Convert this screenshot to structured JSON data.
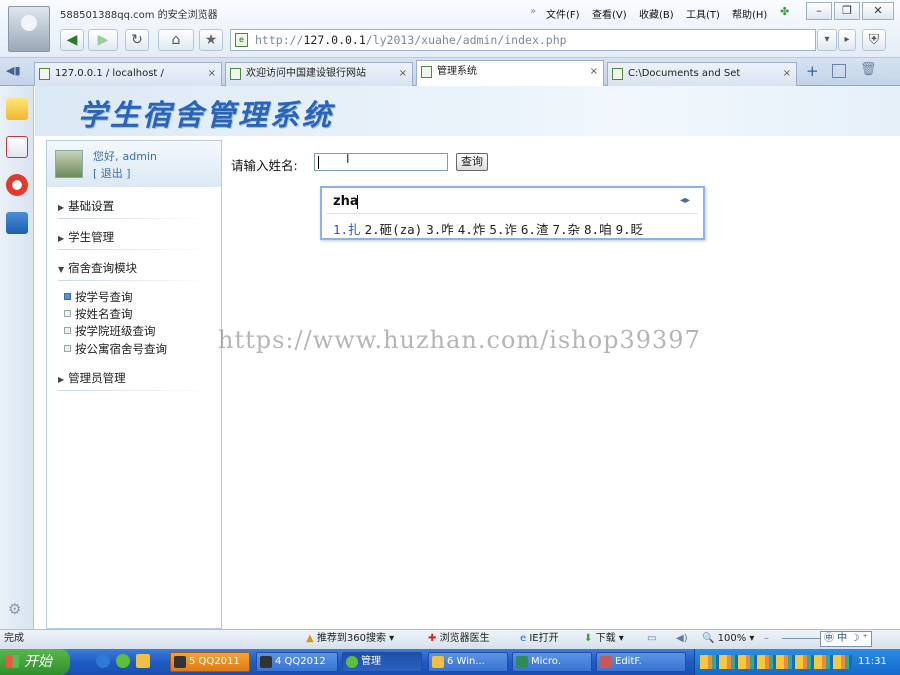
{
  "browser": {
    "title": "588501388qq.com 的安全浏览器",
    "menus": [
      "文件(F)",
      "查看(V)",
      "收藏(B)",
      "工具(T)",
      "帮助(H)"
    ],
    "address": {
      "prefix": "http://",
      "host": "127.0.0.1",
      "path": "/ly2013/xuahe/admin/index.php"
    },
    "tabs": [
      {
        "label": "127.0.0.1 / localhost /",
        "active": false
      },
      {
        "label": "欢迎访问中国建设银行网站",
        "active": false
      },
      {
        "label": "管理系统",
        "active": true
      },
      {
        "label": "C:\\Documents and Set",
        "active": false
      }
    ],
    "tab_close": "×"
  },
  "app": {
    "title": "学生宿舍管理系统",
    "welcome": {
      "greeting": "您好,",
      "user": "admin",
      "logout": "[ 退出 ]"
    },
    "menu": [
      {
        "label": "基础设置",
        "expanded": false
      },
      {
        "label": "学生管理",
        "expanded": false
      },
      {
        "label": "宿舍查询模块",
        "expanded": true,
        "items": [
          "按学号查询",
          "按姓名查询",
          "按学院班级查询",
          "按公寓宿舍号查询"
        ]
      },
      {
        "label": "管理员管理",
        "expanded": false
      }
    ],
    "query": {
      "label": "请输入姓名:",
      "value": "",
      "button": "查询"
    }
  },
  "ime": {
    "composition": "zha",
    "candidates": [
      "1.扎",
      "2.砸(za)",
      "3.咋",
      "4.炸",
      "5.诈",
      "6.渣",
      "7.杂",
      "8.咱",
      "9.眨"
    ]
  },
  "watermark": "https://www.huzhan.com/ishop39397",
  "statusbar": {
    "left": "完成",
    "items": [
      "推荐到360搜索",
      "浏览器医生",
      "IE打开",
      "下载",
      "100%"
    ]
  },
  "taskbar": {
    "start": "开始",
    "buttons": [
      {
        "label": "5 QQ2011",
        "style": "orange"
      },
      {
        "label": "4 QQ2012",
        "style": "normal"
      },
      {
        "label": "管理",
        "style": "active"
      },
      {
        "label": "6 Win...",
        "style": "normal"
      },
      {
        "label": "Micro.",
        "style": "normal"
      },
      {
        "label": "EditF.",
        "style": "normal"
      }
    ],
    "clock": "11:31"
  }
}
